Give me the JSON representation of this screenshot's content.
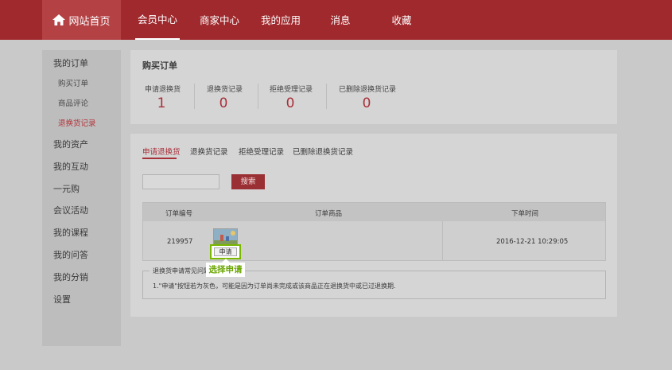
{
  "header": {
    "logo_label": "网站首页",
    "nav": [
      {
        "label": "会员中心"
      },
      {
        "label": "商家中心"
      },
      {
        "label": "我的应用"
      },
      {
        "label": "消息"
      },
      {
        "label": "收藏"
      }
    ],
    "active_index": 0
  },
  "sidebar": {
    "orders_label": "我的订单",
    "order_children": [
      "购买订单",
      "商品评论",
      "退换货记录"
    ],
    "active_child": "退换货记录",
    "groups": [
      "我的资产",
      "我的互动",
      "一元购",
      "会议活动",
      "我的课程",
      "我的问答",
      "我的分销",
      "设置"
    ]
  },
  "summary": {
    "title": "购买订单",
    "stats": [
      {
        "label": "申请退换货",
        "value": "1"
      },
      {
        "label": "退换货记录",
        "value": "0"
      },
      {
        "label": "拒绝受理记录",
        "value": "0"
      },
      {
        "label": "已删除退换货记录",
        "value": "0"
      }
    ]
  },
  "main": {
    "tabs": [
      "申请退换货",
      "退换货记录",
      "拒绝受理记录",
      "已删除退换货记录"
    ],
    "active_tab": "申请退换货",
    "search": {
      "value": "",
      "button_label": "搜索"
    },
    "table": {
      "headers": [
        "订单编号",
        "订单商品",
        "下单时间"
      ],
      "rows": [
        {
          "order_no": "219957",
          "action_label": "申请",
          "time": "2016-12-21 10:29:05"
        }
      ]
    },
    "tooltip": "选择申请",
    "faq": {
      "title": "退换货申请常见问题",
      "text": "1.\"申请\"按钮若为灰色，可能是因为订单尚未完成或该商品正在退换货中或已过退换期."
    }
  },
  "colors": {
    "brand_red": "#a0292d",
    "accent_red": "#a8303a",
    "highlight_green": "#7ab800"
  }
}
